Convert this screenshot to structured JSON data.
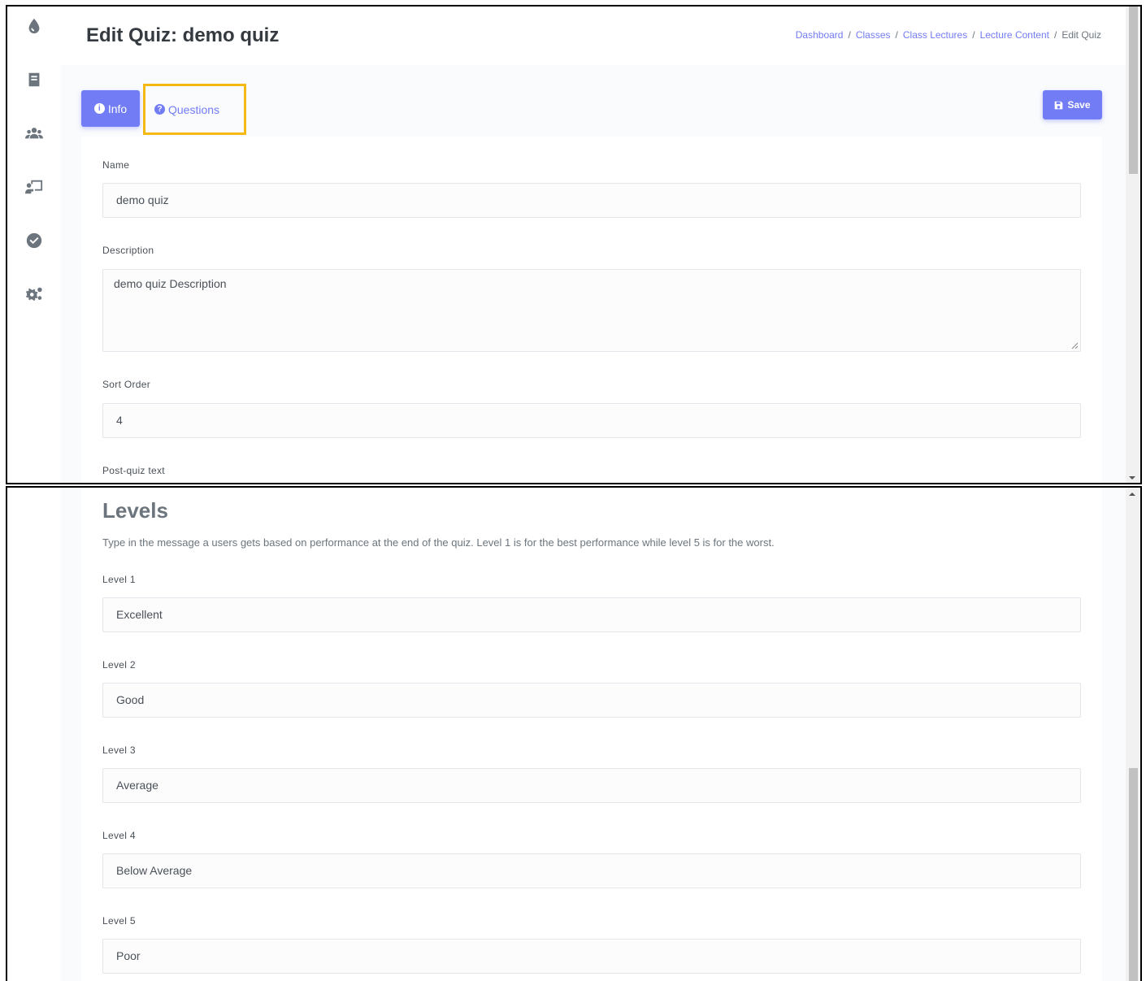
{
  "page": {
    "title": "Edit Quiz: demo quiz"
  },
  "breadcrumb": {
    "items": [
      "Dashboard",
      "Classes",
      "Class Lectures",
      "Lecture Content"
    ],
    "separator": "/",
    "current": "Edit Quiz"
  },
  "tabs": {
    "info_label": "Info",
    "info_icon": "info-circle-icon",
    "questions_label": "Questions",
    "questions_icon": "question-circle-icon"
  },
  "toolbar": {
    "save_label": "Save",
    "save_icon": "floppy-disk-icon"
  },
  "sidebar": {
    "icons": [
      "drop-logo-icon",
      "book-icon",
      "users-icon",
      "presentation-icon",
      "check-circle-icon",
      "gears-icon"
    ]
  },
  "form": {
    "name_label": "Name",
    "name_value": "demo quiz",
    "description_label": "Description",
    "description_value": "demo quiz Description",
    "sort_order_label": "Sort Order",
    "sort_order_value": "4",
    "post_quiz_label": "Post-quiz text"
  },
  "levels": {
    "title": "Levels",
    "description": "Type in the message a users gets based on performance at the end of the quiz. Level 1 is for the best performance while level 5 is for the worst.",
    "items": [
      {
        "label": "Level 1",
        "value": "Excellent"
      },
      {
        "label": "Level 2",
        "value": "Good"
      },
      {
        "label": "Level 3",
        "value": "Average"
      },
      {
        "label": "Level 4",
        "value": "Below Average"
      },
      {
        "label": "Level 5",
        "value": "Poor"
      }
    ]
  },
  "colors": {
    "primary": "#727cf5",
    "highlight": "#f5b916"
  }
}
